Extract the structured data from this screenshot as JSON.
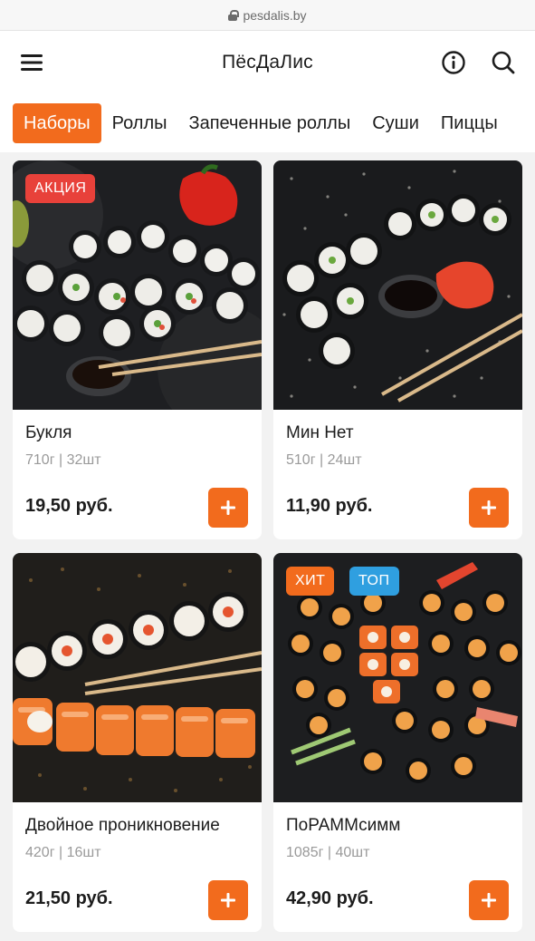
{
  "browser": {
    "url": "pesdalis.by"
  },
  "header": {
    "title": "ПёсДаЛис",
    "icons": {
      "menu": "menu-icon",
      "info": "info-icon",
      "search": "search-icon"
    }
  },
  "tabs": [
    {
      "label": "Наборы",
      "active": true
    },
    {
      "label": "Роллы",
      "active": false
    },
    {
      "label": "Запеченные роллы",
      "active": false
    },
    {
      "label": "Суши",
      "active": false
    },
    {
      "label": "Пиццы",
      "active": false
    }
  ],
  "colors": {
    "accent": "#f26b1d",
    "badge_sale": "#e8413a",
    "badge_hit": "#f26b1d",
    "badge_top": "#2f9fe0"
  },
  "products": [
    {
      "name": "Букля",
      "meta": "710г | 32шт",
      "price": "19,50 руб.",
      "badges": [
        "АКЦИЯ"
      ]
    },
    {
      "name": "Мин Нет",
      "meta": "510г | 24шт",
      "price": "11,90 руб.",
      "badges": []
    },
    {
      "name": "Двойное проникновение",
      "meta": "420г | 16шт",
      "price": "21,50 руб.",
      "badges": []
    },
    {
      "name": "ПоРАММсимм",
      "meta": "1085г | 40шт",
      "price": "42,90 руб.",
      "badges": [
        "ХИТ",
        "ТОП"
      ]
    }
  ]
}
